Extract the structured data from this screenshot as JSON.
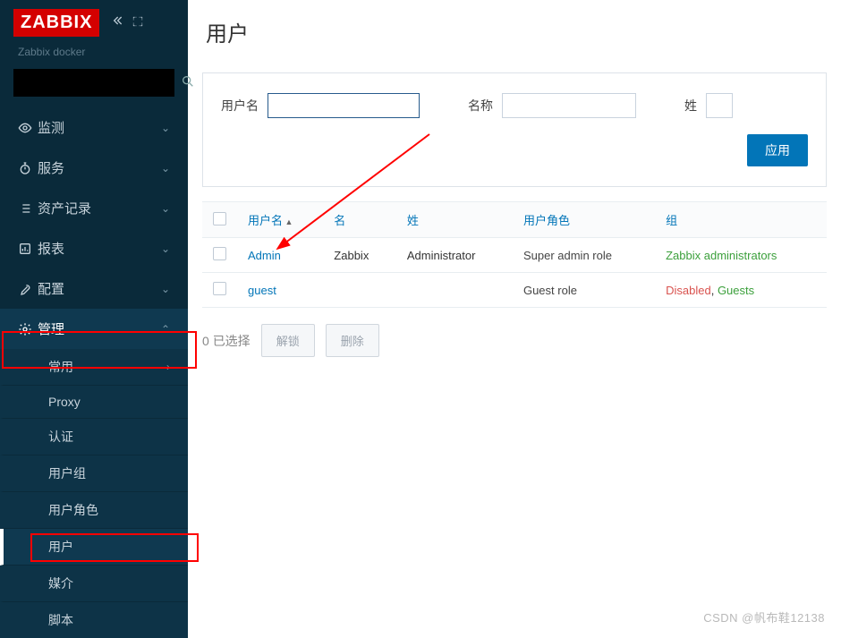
{
  "sidebar": {
    "logo": "ZABBIX",
    "subtitle": "Zabbix docker",
    "nav": [
      {
        "label": "监测"
      },
      {
        "label": "服务"
      },
      {
        "label": "资产记录"
      },
      {
        "label": "报表"
      },
      {
        "label": "配置"
      },
      {
        "label": "管理"
      }
    ],
    "admin_sub": [
      {
        "label": "常用"
      },
      {
        "label": "Proxy"
      },
      {
        "label": "认证"
      },
      {
        "label": "用户组"
      },
      {
        "label": "用户角色"
      },
      {
        "label": "用户"
      },
      {
        "label": "媒介"
      },
      {
        "label": "脚本"
      }
    ]
  },
  "page": {
    "title": "用户"
  },
  "filter": {
    "username_label": "用户名",
    "name_label": "名称",
    "surname_label": "姓",
    "apply": "应用"
  },
  "table": {
    "headers": {
      "username": "用户名",
      "name": "名",
      "surname": "姓",
      "role": "用户角色",
      "group": "组"
    },
    "rows": [
      {
        "username": "Admin",
        "name": "Zabbix",
        "surname": "Administrator",
        "role": "Super admin role",
        "groups": [
          {
            "text": "Zabbix administrators",
            "cls": "grp-green"
          }
        ]
      },
      {
        "username": "guest",
        "name": "",
        "surname": "",
        "role": "Guest role",
        "groups": [
          {
            "text": "Disabled",
            "cls": "grp-red"
          },
          {
            "text": ", ",
            "cls": ""
          },
          {
            "text": "Guests",
            "cls": "grp-green"
          }
        ]
      }
    ]
  },
  "actions": {
    "selected_prefix": "0 ",
    "selected_label": "已选择",
    "unlock": "解锁",
    "delete": "删除"
  },
  "watermark": "CSDN @帆布鞋12138"
}
